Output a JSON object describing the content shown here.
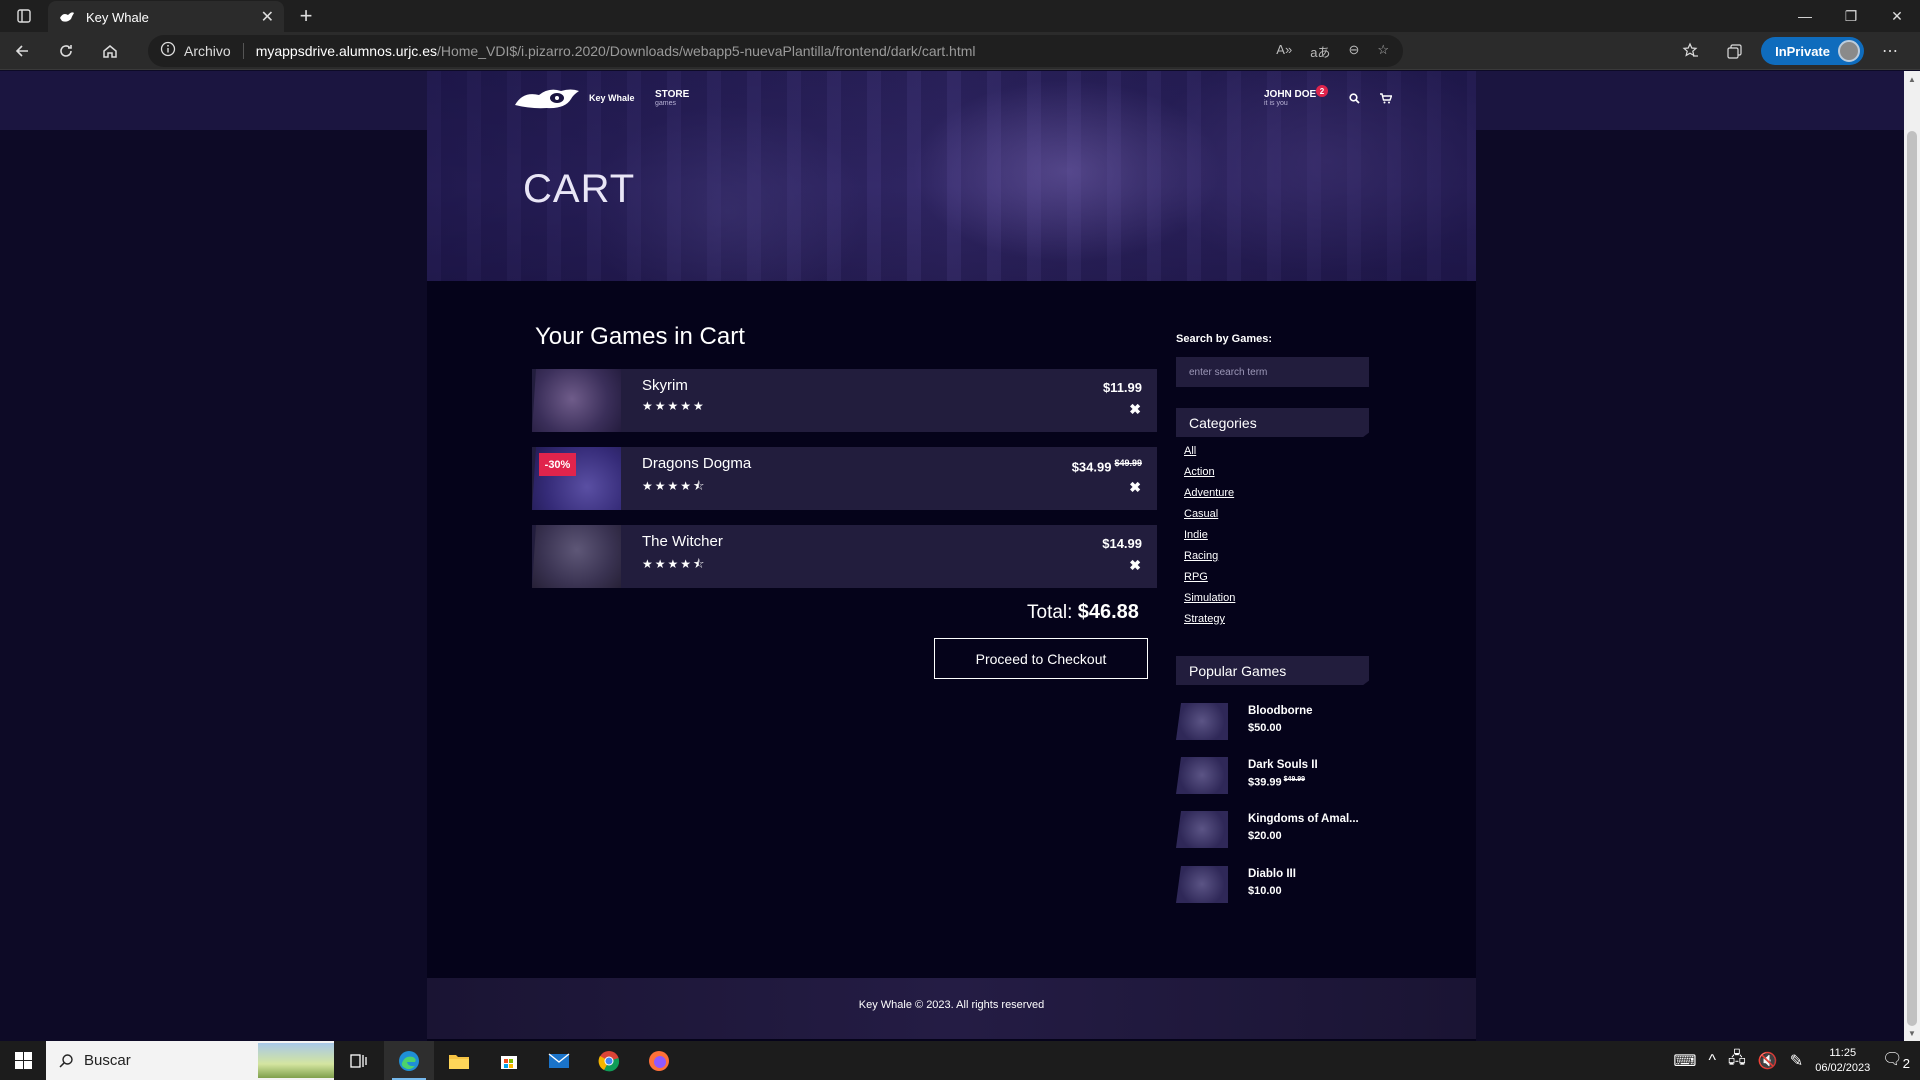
{
  "browser": {
    "tab_title": "Key Whale",
    "security_label": "Archivo",
    "url_host": "myappsdrive.alumnos.urjc.es",
    "url_path": "/Home_VDI$/i.pizarro.2020/Downloads/webapp5-nuevaPlantilla/frontend/dark/cart.html",
    "inprivate_label": "InPrivate"
  },
  "site": {
    "logo_text": "Key Whale",
    "nav": {
      "store_label": "STORE",
      "store_sub": "games"
    },
    "user": {
      "name": "JOHN DOE",
      "sub": "it is you",
      "badge": "2"
    },
    "hero_title": "CART"
  },
  "cart": {
    "heading": "Your Games in Cart",
    "items": [
      {
        "name": "Skyrim",
        "price": "$11.99",
        "old_price": "",
        "discount": "",
        "rating": 5,
        "stars": "★★★★★"
      },
      {
        "name": "Dragons Dogma",
        "price": "$34.99",
        "old_price": "$49.99",
        "discount": "-30%",
        "rating": 4.5,
        "stars": "★★★★⯪"
      },
      {
        "name": "The Witcher",
        "price": "$14.99",
        "old_price": "",
        "discount": "",
        "rating": 4.5,
        "stars": "★★★★⯪"
      }
    ],
    "remove_glyph": "✖",
    "total_label": "Total:",
    "total_value": "$46.88",
    "checkout_label": "Proceed to Checkout"
  },
  "sidebar": {
    "search_label": "Search by Games:",
    "search_placeholder": "enter search term",
    "categories_title": "Categories",
    "categories": [
      "All",
      "Action",
      "Adventure",
      "Casual",
      "Indie",
      "Racing",
      "RPG",
      "Simulation",
      "Strategy"
    ],
    "popular_title": "Popular Games",
    "popular": [
      {
        "name": "Bloodborne",
        "price": "$50.00",
        "old_price": ""
      },
      {
        "name": "Dark Souls II",
        "price": "$39.99",
        "old_price": "$49.99"
      },
      {
        "name": "Kingdoms of Amal...",
        "price": "$20.00",
        "old_price": ""
      },
      {
        "name": "Diablo III",
        "price": "$10.00",
        "old_price": ""
      }
    ]
  },
  "footer": {
    "text": "Key Whale © 2023. All rights reserved"
  },
  "taskbar": {
    "search_placeholder": "Buscar",
    "time": "11:25",
    "date": "06/02/2023",
    "notifications": "2"
  },
  "colors": {
    "accent_red": "#e0244c",
    "panel": "#221d3d",
    "page_bg": "#05031a",
    "edge_blue": "#0f6cbd"
  }
}
